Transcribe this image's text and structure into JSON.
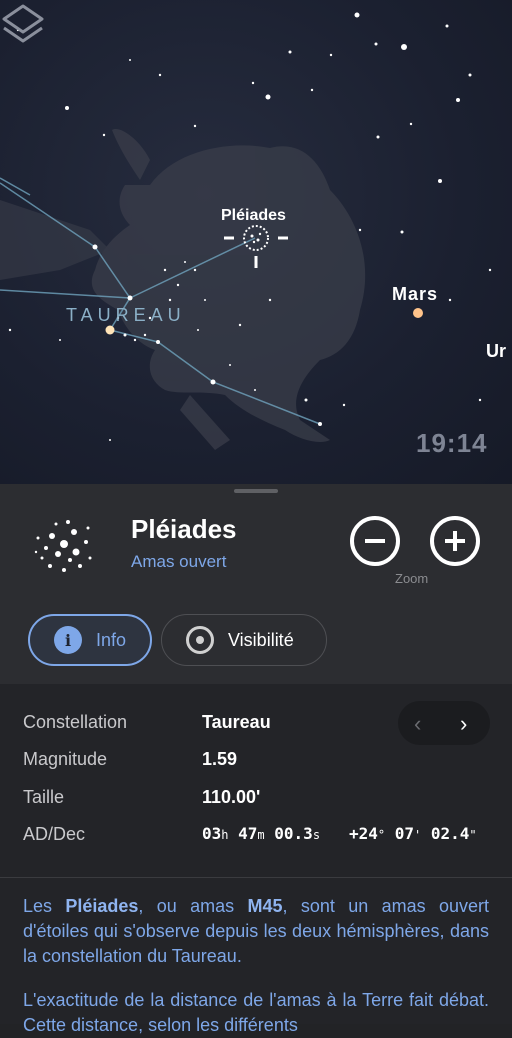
{
  "sky": {
    "constellation_label": "TAUREAU",
    "pleiades_label": "Pléiades",
    "mars_label": "Mars",
    "uranus_label": "Ur",
    "time": "19:14",
    "layers_icon": "layers-icon"
  },
  "object": {
    "title": "Pléiades",
    "subtitle": "Amas ouvert",
    "zoom_label": "Zoom",
    "zoom_out_icon": "minus-circle-icon",
    "zoom_in_icon": "plus-circle-icon"
  },
  "tabs": [
    {
      "label": "Info",
      "icon": "info-icon",
      "active": true
    },
    {
      "label": "Visibilité",
      "icon": "target-icon",
      "active": false
    }
  ],
  "details": {
    "rows": [
      {
        "key": "Constellation",
        "value": "Taureau"
      },
      {
        "key": "Magnitude",
        "value": "1.59"
      },
      {
        "key": "Taille",
        "value": "110.00'"
      }
    ],
    "radec_key": "AD/Dec",
    "ra": {
      "h": "03",
      "m": "47",
      "s": "00.3"
    },
    "dec": {
      "d": "+24",
      "m": "07",
      "s": "02.4"
    },
    "prev": "‹",
    "next": "›"
  },
  "description": {
    "p1_a": "Les ",
    "p1_b": "Pléiades",
    "p1_c": ", ou amas ",
    "p1_d": "M45",
    "p1_e": ", sont un amas ouvert d'étoiles qui s'observe depuis les deux hémisphères, dans la constellation du Taureau.",
    "p2": "L'exactitude de la distance de l'amas à la Terre fait débat. Cette distance, selon les différents"
  },
  "colors": {
    "accent": "#7ea7e8",
    "sheet": "#2c2d31",
    "sky": "#1b2030"
  }
}
